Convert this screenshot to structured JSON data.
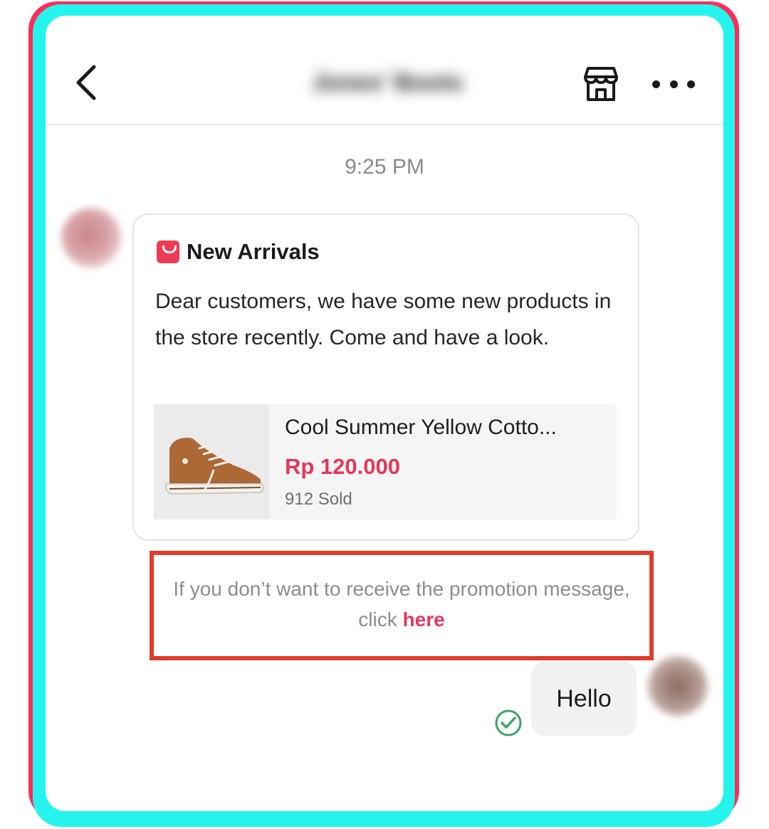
{
  "header": {
    "contact_name": "Jones' Boots",
    "back_icon": "chevron-left-icon",
    "shop_icon": "shop-icon",
    "more_icon": "more-dots-icon"
  },
  "chat": {
    "timestamp": "9:25 PM",
    "promo": {
      "title": "New Arrivals",
      "icon": "shopping-bag-icon",
      "body": "Dear customers, we have some new products in the store recently. Come and have a look.",
      "product": {
        "name": "Cool Summer Yellow Cotto...",
        "price": "Rp 120.000",
        "sold": "912 Sold"
      }
    },
    "optout": {
      "text": "If you don’t want to receive the promotion message, click ",
      "link": "here"
    },
    "sent_message": "Hello",
    "read_icon": "check-circle-icon"
  },
  "colors": {
    "accent": "#e5375a",
    "highlight_border": "#df3d2a",
    "frame_red": "#ff2c55",
    "frame_cyan": "#25f4ee"
  }
}
